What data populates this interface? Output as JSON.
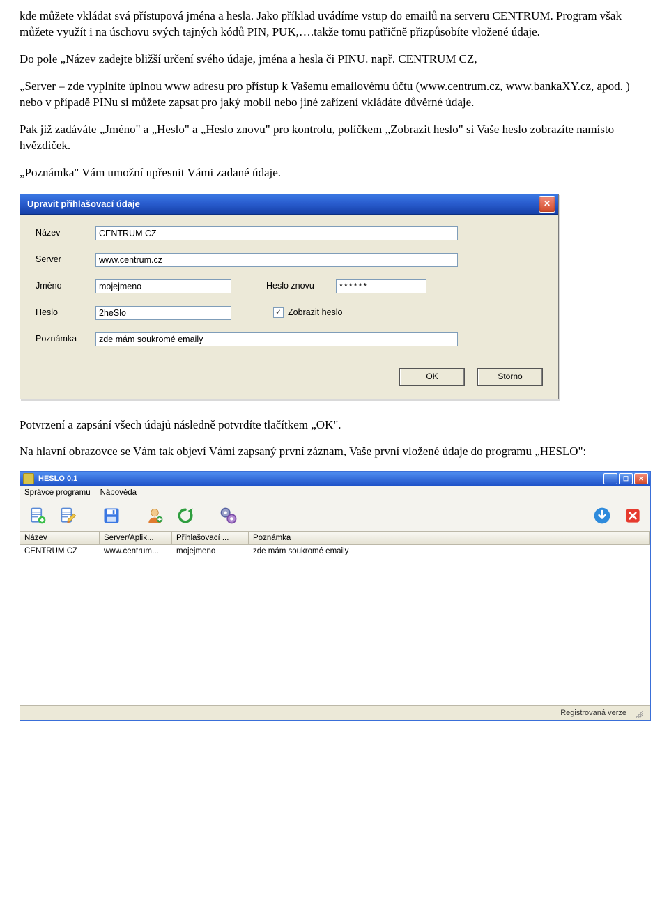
{
  "article": {
    "p1": "kde můžete vkládat svá přístupová jména a hesla. Jako příklad uvádíme vstup do emailů na serveru CENTRUM. Program však můžete využít i na úschovu svých tajných kódů PIN, PUK,….takže tomu patřičně přizpůsobíte vložené údaje.",
    "p2": "Do pole „Název zadejte bližší určení svého údaje, jména a hesla či  PINU.  např. CENTRUM CZ,",
    "p3": "„Server – zde vyplníte úplnou www adresu pro přístup k Vašemu emailovému účtu (www.centrum.cz, www.bankaXY.cz, apod. ) nebo v případě PINu si můžete zapsat pro jaký mobil nebo jiné zařízení vkládáte důvěrné údaje.",
    "p4": "Pak již zadáváte „Jméno\" a „Heslo\" a „Heslo znovu\"   pro kontrolu, políčkem  „Zobrazit heslo\" si Vaše heslo zobrazíte namísto hvězdiček.",
    "p5": "„Poznámka\" Vám umožní upřesnit Vámi zadané údaje.",
    "p6": "Potvrzení a zapsání všech údajů následně potvrdíte tlačítkem „OK\".",
    "p7": "Na hlavní obrazovce se Vám tak objeví Vámi zapsaný první záznam, Vaše první vložené údaje  do programu „HESLO\":"
  },
  "dialog": {
    "title": "Upravit přihlašovací údaje",
    "labels": {
      "nazev": "Název",
      "server": "Server",
      "jmeno": "Jméno",
      "heslo_znovu": "Heslo znovu",
      "heslo": "Heslo",
      "zobrazit_heslo": "Zobrazit heslo",
      "poznamka": "Poznámka"
    },
    "values": {
      "nazev": "CENTRUM CZ",
      "server": "www.centrum.cz",
      "jmeno": "mojejmeno",
      "heslo_znovu": "******",
      "heslo": "2heSlo",
      "poznamka": "zde mám soukromé emaily"
    },
    "checkbox_checked": "✓",
    "buttons": {
      "ok": "OK",
      "storno": "Storno"
    }
  },
  "app": {
    "title": "HESLO 0.1",
    "menu": {
      "spravce": "Správce programu",
      "napoveda": "Nápověda"
    },
    "columns": {
      "nazev": "Název",
      "server": "Server/Aplik...",
      "login": "Přihlašovací ...",
      "poznamka": "Poznámka"
    },
    "row": {
      "nazev": "CENTRUM CZ",
      "server": "www.centrum...",
      "login": "mojejmeno",
      "poznamka": "zde mám soukromé emaily"
    },
    "status": "Registrovaná verze"
  }
}
